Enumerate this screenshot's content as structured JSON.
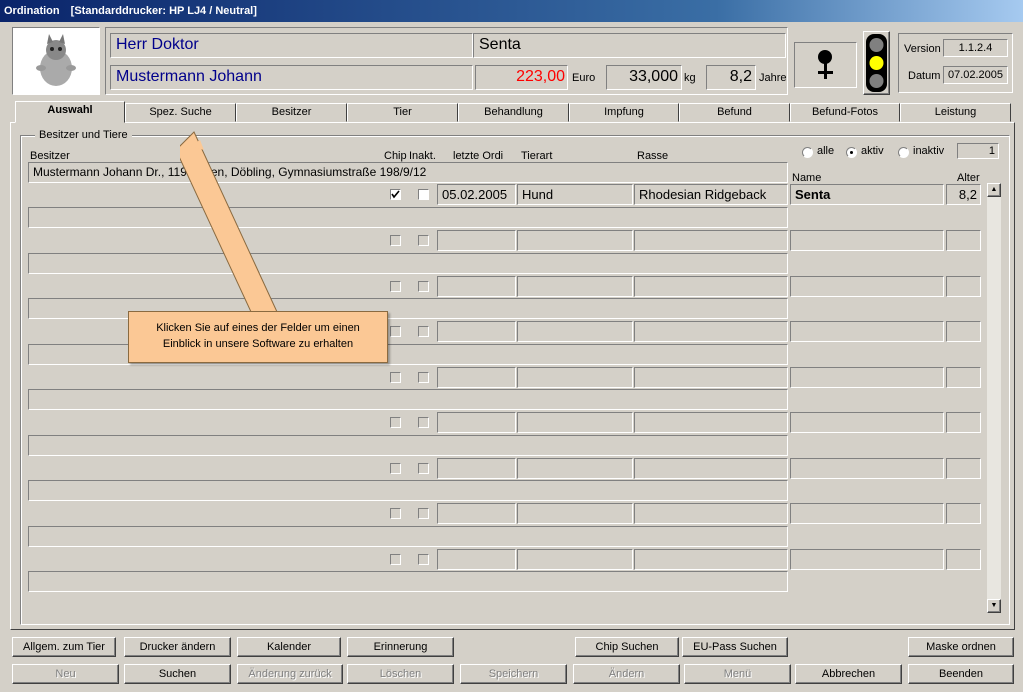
{
  "window": {
    "title": "Ordination",
    "printer": "[Standarddrucker: HP LJ4 / Neutral]"
  },
  "header": {
    "doctor": "Herr Doktor",
    "patient_name": "Senta",
    "owner_name": "Mustermann Johann",
    "amount": "223,00",
    "amount_unit": "Euro",
    "weight": "33,000",
    "weight_unit": "kg",
    "age": "8,2",
    "age_unit": "Jahre",
    "version_label": "Version",
    "version": "1.1.2.4",
    "date_label": "Datum",
    "date": "07.02.2005",
    "amount_color": "#ff0000",
    "name_color": "#00008b"
  },
  "tabs": [
    "Auswahl",
    "Spez. Suche",
    "Besitzer",
    "Tier",
    "Behandlung",
    "Impfung",
    "Befund",
    "Befund-Fotos",
    "Leistung"
  ],
  "group": {
    "title": "Besitzer und Tiere"
  },
  "columns": {
    "besitzer": "Besitzer",
    "chip": "Chip",
    "inakt": "Inakt.",
    "letzte": "letzte Ordi",
    "tierart": "Tierart",
    "rasse": "Rasse",
    "name": "Name",
    "alter": "Alter"
  },
  "filter": {
    "alle": "alle",
    "aktiv": "aktiv",
    "inaktiv": "inaktiv",
    "count": "1"
  },
  "owner_row": "Mustermann Johann Dr., 1190 Wien, Döbling, Gymnasiumstraße 198/9/12",
  "animal_row": {
    "date": "05.02.2005",
    "tierart": "Hund",
    "rasse": "Rhodesian Ridgeback",
    "name": "Senta",
    "alter": "8,2"
  },
  "tooltip": "Klicken Sie auf eines der Felder um einen Einblick in unsere Software zu erhalten",
  "buttons_row1": [
    "Allgem. zum Tier",
    "Drucker ändern",
    "Kalender",
    "Erinnerung",
    "Chip Suchen",
    "EU-Pass Suchen",
    "Maske ordnen"
  ],
  "buttons_row2": [
    "Neu",
    "Suchen",
    "Änderung zurück",
    "Löschen",
    "Speichern",
    "Ändern",
    "Menü",
    "Abbrechen",
    "Beenden"
  ]
}
